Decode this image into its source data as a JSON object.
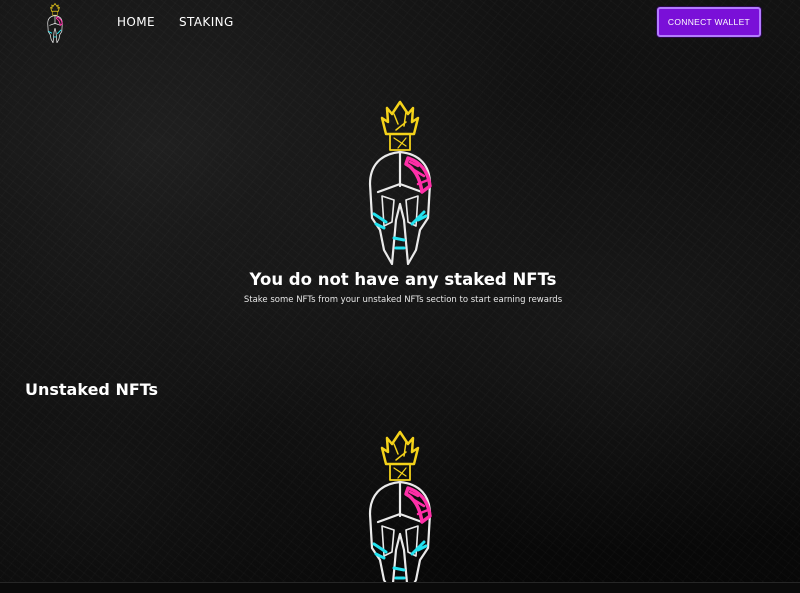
{
  "nav": {
    "logo_icon": "spartan-helmet-logo-icon",
    "home_label": "HOME",
    "staking_label": "STAKING",
    "connect_label": "CONNECT WALLET"
  },
  "staked": {
    "empty_icon": "spartan-helmet-icon",
    "empty_title": "You do not have any staked NFTs",
    "empty_subtitle": "Stake some NFTs from your unstaked NFTs section to start earning rewards"
  },
  "unstaked": {
    "title": "Unstaked NFTs",
    "empty_icon": "spartan-helmet-icon"
  },
  "colors": {
    "background": "#0b0b0b",
    "accent": "#7a10d8",
    "accent_border": "#b37bff",
    "helmet_yellow": "#f4d21a",
    "helmet_pink": "#ff2fa8",
    "helmet_cyan": "#22e3f0"
  }
}
